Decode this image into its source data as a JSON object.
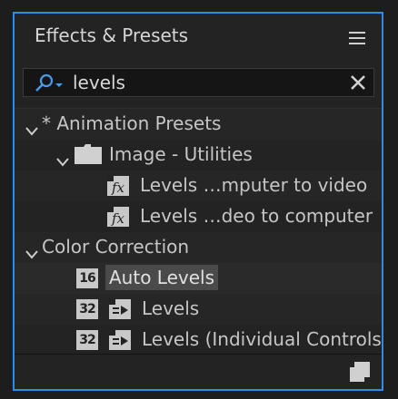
{
  "panel": {
    "title": "Effects & Presets",
    "menu_icon": "hamburger-menu-icon"
  },
  "search": {
    "value": "levels",
    "search_icon": "magnifier-dropdown-icon",
    "clear_icon": "close-icon"
  },
  "tree": {
    "animation_presets": {
      "label": "* Animation Presets",
      "expanded": true
    },
    "image_utilities": {
      "label": "Image - Utilities",
      "expanded": true
    },
    "preset_1": {
      "label": "Levels …mputer to video"
    },
    "preset_2": {
      "label": "Levels …deo to computer"
    },
    "color_correction": {
      "label": "Color Correction",
      "expanded": true
    },
    "effect_1": {
      "label": "Auto Levels",
      "bit_depth": "16",
      "selected": true
    },
    "effect_2": {
      "label": "Levels",
      "bit_depth": "32"
    },
    "effect_3": {
      "label": "Levels (Individual Controls)",
      "bit_depth": "32"
    }
  },
  "footer": {
    "new_icon": "new-item-icon"
  },
  "colors": {
    "accent": "#2d8ceb",
    "panel_bg": "#232323",
    "highlight": "#4a4a4a"
  }
}
